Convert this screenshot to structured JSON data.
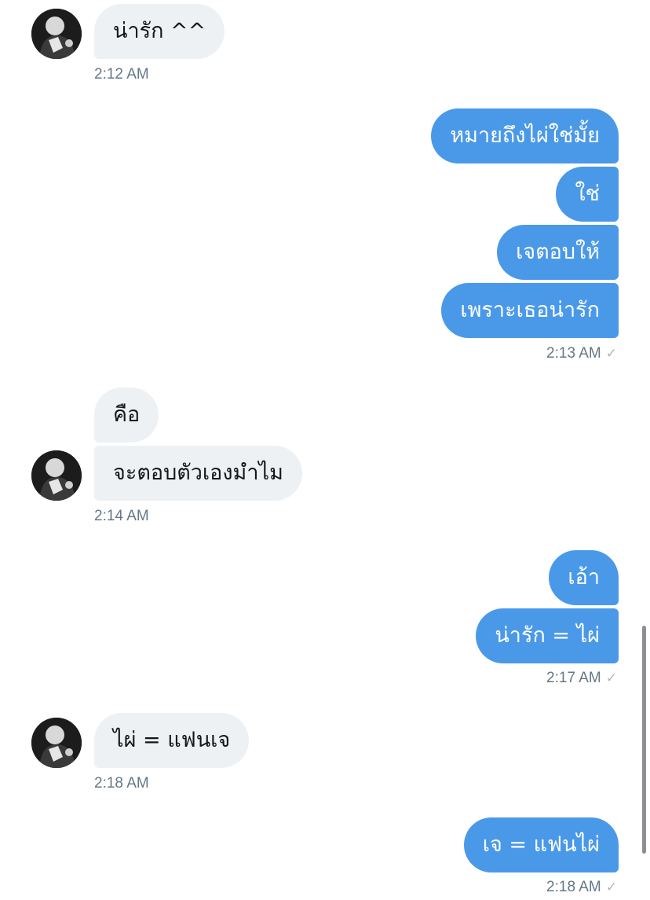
{
  "messages": {
    "m1": {
      "text": "น่ารัก ^^",
      "time": "2:12 AM"
    },
    "m2": {
      "text": "หมายถึงไผ่ใช่มั้ย"
    },
    "m3": {
      "text": "ใช่"
    },
    "m4": {
      "text": "เจตอบให้"
    },
    "m5": {
      "text": "เพราะเธอน่ารัก",
      "time": "2:13 AM"
    },
    "m6": {
      "text": "คือ"
    },
    "m7": {
      "text": "จะตอบตัวเองมำไม",
      "time": "2:14 AM"
    },
    "m8": {
      "text": "เอ้า"
    },
    "m9": {
      "text": "น่ารัก = ไผ่",
      "time": "2:17 AM"
    },
    "m10": {
      "text": "ไผ่ = แฟนเจ",
      "time": "2:18 AM"
    },
    "m11": {
      "text": "เจ = แฟนไผ่",
      "time": "2:18 AM"
    }
  },
  "read_receipt_glyph": "✓",
  "colors": {
    "outgoing_bubble": "#4a99e9",
    "incoming_bubble": "#eef1f4",
    "timestamp": "#657786",
    "receipt": "#aab8c2"
  },
  "icons": {
    "avatar": "avatar-photo",
    "receipt": "checkmark-icon"
  }
}
